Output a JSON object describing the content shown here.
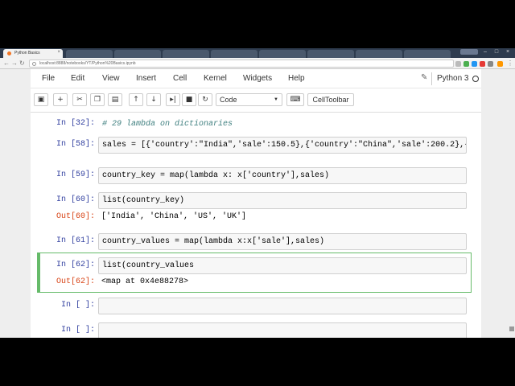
{
  "browser": {
    "active_tab": "Python Basics",
    "background_tabs": [
      "",
      "",
      "",
      "",
      "",
      "",
      "",
      ""
    ],
    "url": "localhost:8888/notebooks/YT/Python%20Basics.ipynb"
  },
  "menu": [
    "File",
    "Edit",
    "View",
    "Insert",
    "Cell",
    "Kernel",
    "Widgets",
    "Help"
  ],
  "kernel_name": "Python 3",
  "toolbar": {
    "cell_type": "Code",
    "celltoolbar_label": "CellToolbar",
    "icons": [
      "save-icon",
      "plus-icon",
      "cut-icon",
      "copy-icon",
      "paste-icon",
      "arrow-up-icon",
      "arrow-down-icon",
      "step-forward-icon",
      "stop-icon",
      "refresh-icon",
      "keyboard-icon"
    ]
  },
  "cells": [
    {
      "prompt": "In [32]:",
      "code": "# 29 lambda on dictionaries"
    },
    {
      "prompt": "In [58]:",
      "code": "sales = [{'country':\"India\",'sale':150.5},{'country':\"China\",'sale':200.2},{'coun"
    },
    {
      "prompt": "In [59]:",
      "code": "country_key = map(lambda x: x['country'],sales)"
    },
    {
      "prompt": "In [60]:",
      "code": "list(country_key)",
      "out_prompt": "Out[60]:",
      "output": "['India', 'China', 'US', 'UK']"
    },
    {
      "prompt": "In [61]:",
      "code": "country_values = map(lambda x:x['sale'],sales)"
    },
    {
      "prompt": "In [62]:",
      "code": "list(country_values",
      "out_prompt": "Out[62]:",
      "output": "<map at 0x4e88278>"
    },
    {
      "prompt": "In [ ]:",
      "code": ""
    },
    {
      "prompt": "In [ ]:",
      "code": ""
    }
  ]
}
